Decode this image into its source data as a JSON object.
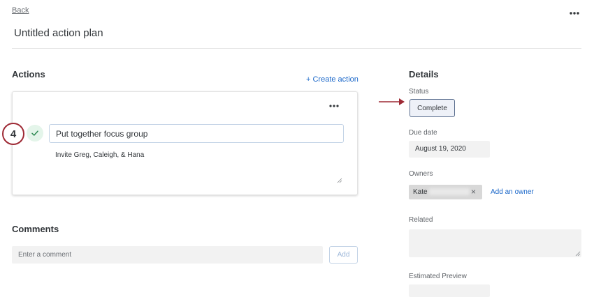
{
  "header": {
    "back_label": "Back",
    "more_icon": "more-horizontal-icon",
    "title": "Untitled action plan"
  },
  "actions": {
    "heading": "Actions",
    "create_label": "+ Create action",
    "step_number": "4",
    "card": {
      "more_icon": "more-horizontal-icon",
      "check_icon": "checkmark-icon",
      "title_value": "Put together focus group",
      "description_value": "Invite Greg, Caleigh, & Hana"
    }
  },
  "comments": {
    "heading": "Comments",
    "placeholder": "Enter a comment",
    "add_label": "Add"
  },
  "details": {
    "heading": "Details",
    "status_label": "Status",
    "status_value": "Complete",
    "due_label": "Due date",
    "due_value": "August 19, 2020",
    "owners_label": "Owners",
    "owner_name": "Kate",
    "owner_remove": "×",
    "add_owner_label": "Add an owner",
    "related_label": "Related",
    "estimate_label": "Estimated Preview"
  },
  "colors": {
    "link": "#1a67c9",
    "annotation": "#9e2a35",
    "check_bg": "#e4f5ea",
    "check": "#2d8a52"
  }
}
